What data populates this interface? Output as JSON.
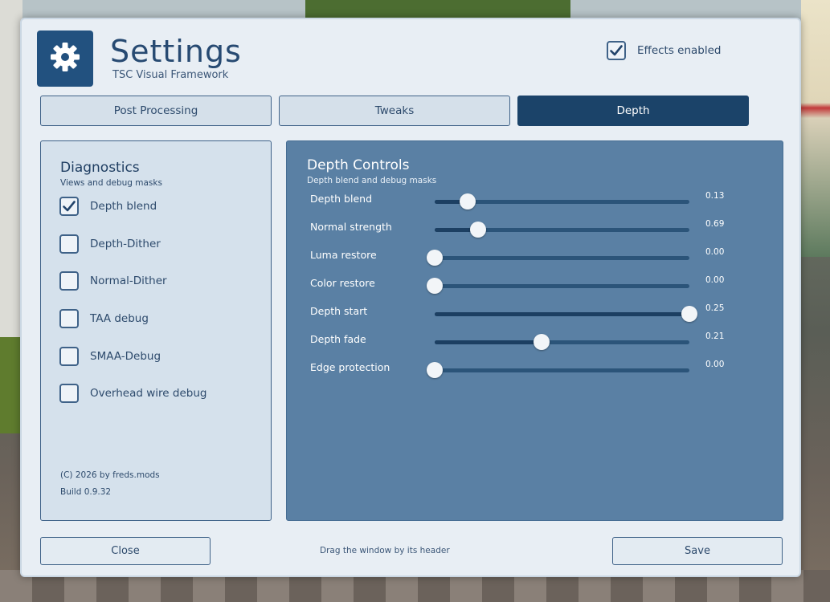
{
  "header": {
    "title": "Settings",
    "subtitle": "TSC Visual Framework",
    "logo_icon": "gear-icon",
    "effects_toggle": {
      "label": "Effects enabled",
      "checked": true
    }
  },
  "tabs": [
    {
      "label": "Post Processing",
      "active": false
    },
    {
      "label": "Tweaks",
      "active": false
    },
    {
      "label": "Depth",
      "active": true
    }
  ],
  "diagnostics": {
    "title": "Diagnostics",
    "subtitle": "Views and debug masks",
    "items": [
      {
        "label": "Depth blend",
        "checked": true
      },
      {
        "label": "Depth-Dither",
        "checked": false
      },
      {
        "label": "Normal-Dither",
        "checked": false
      },
      {
        "label": "TAA debug",
        "checked": false
      },
      {
        "label": "SMAA-Debug",
        "checked": false
      },
      {
        "label": "Overhead wire debug",
        "checked": false
      }
    ],
    "copyright": "(C) 2026 by freds.mods",
    "build": "Build 0.9.32"
  },
  "depth_controls": {
    "title": "Depth Controls",
    "subtitle": "Depth blend and debug masks",
    "sliders": [
      {
        "label": "Depth blend",
        "value_text": "0.13",
        "level": 0.13
      },
      {
        "label": "Normal strength",
        "value_text": "0.69",
        "level": 0.17
      },
      {
        "label": "Luma restore",
        "value_text": "0.00",
        "level": 0.0
      },
      {
        "label": "Color restore",
        "value_text": "0.00",
        "level": 0.0
      },
      {
        "label": "Depth start",
        "value_text": "0.25",
        "level": 1.0
      },
      {
        "label": "Depth fade",
        "value_text": "0.21",
        "level": 0.42
      },
      {
        "label": "Edge protection",
        "value_text": "0.00",
        "level": 0.0
      }
    ]
  },
  "footer": {
    "close_label": "Close",
    "hint": "Drag the window by its header",
    "save_label": "Save"
  },
  "colors": {
    "accent": "#1b4369",
    "panel_blue": "#5a80a4",
    "window_bg": "#e8eef4"
  }
}
